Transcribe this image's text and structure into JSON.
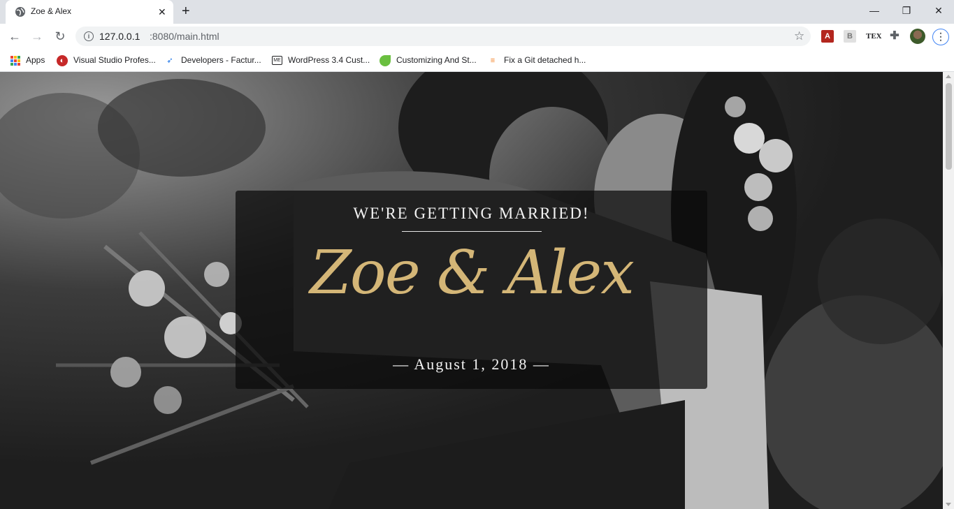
{
  "browser": {
    "tab_title": "Zoe & Alex",
    "new_tab": "+",
    "url_host": "127.0.0.1",
    "url_path": ":8080/main.html",
    "bookmarks": [
      {
        "label": "Apps",
        "icon": "apps-grid-icon"
      },
      {
        "label": "Visual Studio Profes...",
        "icon": "visual-studio-icon"
      },
      {
        "label": "Developers - Factur...",
        "icon": "bird-icon"
      },
      {
        "label": "WordPress 3.4 Cust...",
        "icon": "chat-icon"
      },
      {
        "label": "Customizing And St...",
        "icon": "leaf-icon"
      },
      {
        "label": "Fix a Git detached h...",
        "icon": "stackoverflow-icon"
      }
    ],
    "extensions": [
      "pdf-icon",
      "bi-icon",
      "tex-icon",
      "puzzle-icon"
    ]
  },
  "hero": {
    "tagline": "WE'RE GETTING MARRIED!",
    "names": "Zoe & Alex",
    "date": "— August 1, 2018 —"
  },
  "colors": {
    "accent_gold": "#d4b677",
    "card_bg": "rgba(10,10,10,0.72)"
  }
}
